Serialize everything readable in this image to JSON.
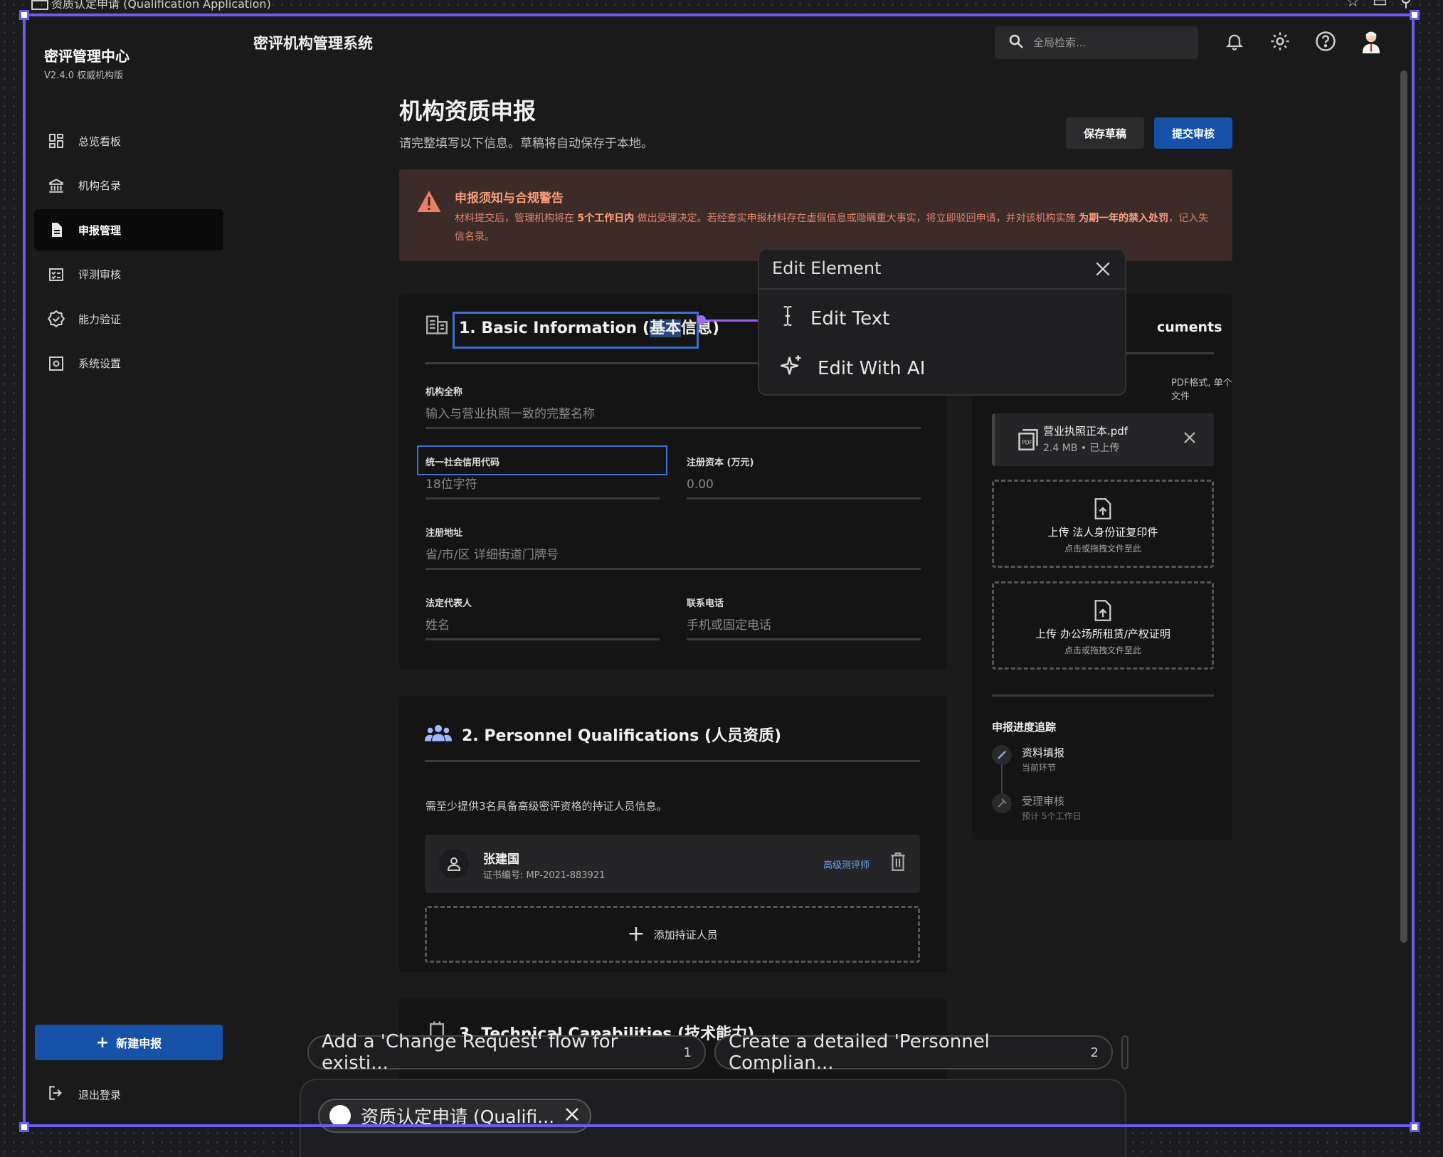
{
  "window": {
    "title": "资质认定申请 (Qualification Application)"
  },
  "sidebar": {
    "brand": "密评管理中心",
    "version": "V2.4.0 权威机构版",
    "items": [
      {
        "label": "总览看板",
        "icon": "dashboard-icon"
      },
      {
        "label": "机构名录",
        "icon": "institution-icon"
      },
      {
        "label": "申报管理",
        "icon": "document-icon",
        "active": true
      },
      {
        "label": "评测审核",
        "icon": "checklist-icon"
      },
      {
        "label": "能力验证",
        "icon": "verified-icon"
      },
      {
        "label": "系统设置",
        "icon": "settings-icon"
      }
    ],
    "new_button": "新建申报",
    "logout": "退出登录"
  },
  "header": {
    "system_title": "密评机构管理系统",
    "search_placeholder": "全局检索..."
  },
  "page": {
    "title": "机构资质申报",
    "subtitle": "请完整填写以下信息。草稿将自动保存于本地。",
    "save_draft": "保存草稿",
    "submit": "提交审核"
  },
  "warning": {
    "title": "申报须知与合规警告",
    "body_1": "材料提交后，管理机构将在 ",
    "body_bold_1": "5个工作日内",
    "body_2": " 做出受理决定。若经查实申报材料存在虚假信息或隐瞒重大事实，将立即驳回申请，并对该机构实施 ",
    "body_bold_2": "为期一年的禁入处罚",
    "body_3": "，记入失信名录。"
  },
  "basic": {
    "title_pre": "1. Basic Information (",
    "title_hl": "基本",
    "title_post": "信息)",
    "fields": {
      "full_name_label": "机构全称",
      "full_name_ph": "输入与营业执照一致的完整名称",
      "credit_code_label": "统一社会信用代码",
      "credit_code_ph": "18位字符",
      "capital_label": "注册资本 (万元)",
      "capital_ph": "0.00",
      "address_label": "注册地址",
      "address_ph": "省/市/区 详细街道门牌号",
      "legal_rep_label": "法定代表人",
      "legal_rep_ph": "姓名",
      "phone_label": "联系电话",
      "phone_ph": "手机或固定电话"
    }
  },
  "personnel": {
    "title": "2. Personnel Qualifications (人员资质)",
    "note": "需至少提供3名具备高级密评资格的持证人员信息。",
    "people": [
      {
        "name": "张建国",
        "cert": "证书编号: MP-2021-883921",
        "tag": "高级测评师"
      }
    ],
    "add_label": "添加持证人员"
  },
  "technical": {
    "title": "3. Technical Capabilities (技术能力)"
  },
  "documents": {
    "title_fragment": "cuments",
    "note_fragment": "PDF格式, 单个文件",
    "file": {
      "name": "营业执照正本.pdf",
      "meta": "2.4 MB • 已上传"
    },
    "uploads": [
      {
        "title": "上传 法人身份证复印件",
        "hint": "点击或拖拽文件至此"
      },
      {
        "title": "上传 办公场所租赁/产权证明",
        "hint": "点击或拖拽文件至此"
      }
    ],
    "progress_title": "申报进度追踪",
    "steps": [
      {
        "label": "资料填报",
        "sub": "当前环节"
      },
      {
        "label": "受理审核",
        "sub": "预计 5个工作日"
      }
    ]
  },
  "editor": {
    "popover_title": "Edit Element",
    "edit_text": "Edit Text",
    "edit_ai": "Edit With AI"
  },
  "suggestions": [
    {
      "label": "Add a 'Change Request' flow for existi...",
      "num": "1"
    },
    {
      "label": "Create a detailed 'Personnel Complian...",
      "num": "2"
    }
  ],
  "chat": {
    "tab_label": "资质认定申请 (Qualifi..."
  },
  "colors": {
    "accent": "#1652a8",
    "selection": "#6b5df0",
    "warning_text": "#e0856a"
  }
}
